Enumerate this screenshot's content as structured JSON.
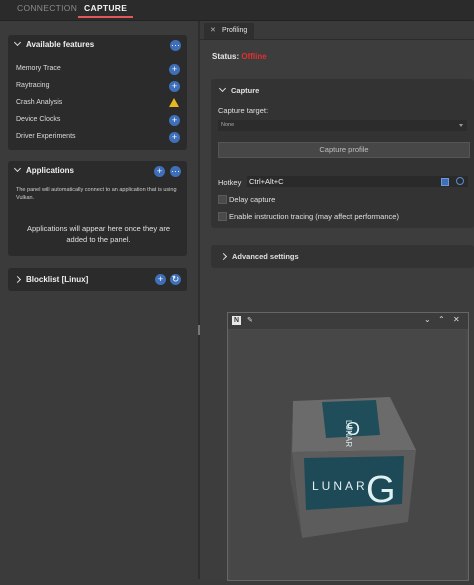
{
  "tabs": {
    "connection": "CONNECTION",
    "capture": "CAPTURE"
  },
  "available_features": {
    "title": "Available features",
    "items": [
      "Memory Trace",
      "Raytracing",
      "Crash Analysis",
      "Device Clocks",
      "Driver Experiments"
    ],
    "icons": [
      "plus-icon",
      "plus-icon",
      "warning-icon",
      "plus-icon",
      "plus-icon"
    ]
  },
  "applications": {
    "title": "Applications",
    "info": "The panel will automatically connect to an application that is using Vulkan.",
    "empty_line1": "Applications will appear here once they are",
    "empty_line2": "added to the panel."
  },
  "blocklist": {
    "title": "Blocklist [Linux]"
  },
  "profiling_tab": {
    "label": "Profiling",
    "close": "✕"
  },
  "status": {
    "label": "Status:",
    "value": "Offline"
  },
  "capture": {
    "title": "Capture",
    "target_label": "Capture target:",
    "target_value": "None",
    "capture_button": "Capture profile",
    "hotkey_label": "Hotkey",
    "hotkey_value": "Ctrl+Alt+C",
    "delay_label": "Delay capture",
    "instr_label": "Enable instruction tracing (may affect performance)"
  },
  "advanced": {
    "title": "Advanced settings"
  },
  "viewer_window": {
    "logo_text": "LUNAR",
    "logo_letter": "G",
    "controls": [
      "⌄",
      "⌃",
      "✕"
    ]
  },
  "colors": {
    "accent": "#3f6fb8",
    "tab_underline": "#e05a5a",
    "offline": "#e03030",
    "warning": "#e8b820"
  }
}
